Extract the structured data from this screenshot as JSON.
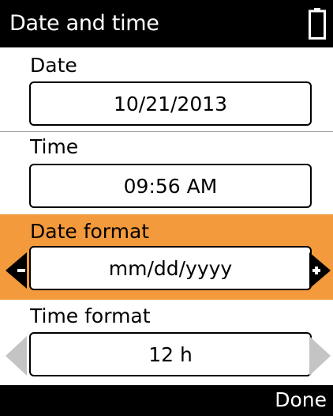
{
  "header": {
    "title": "Date and time",
    "battery_icon": "battery-icon"
  },
  "sections": {
    "date": {
      "label": "Date",
      "value": "10/21/2013"
    },
    "time": {
      "label": "Time",
      "value": "09:56 AM"
    },
    "date_format": {
      "label": "Date format",
      "value": "mm/dd/yyyy",
      "selected": true
    },
    "time_format": {
      "label": "Time format",
      "value": "12 h"
    }
  },
  "footer": {
    "done_label": "Done"
  },
  "colors": {
    "highlight": "#f39a3c",
    "bar": "#000000",
    "inactive_arrow": "#bdbdbd"
  },
  "icons": {
    "left": "left-arrow-icon",
    "right": "right-arrow-icon"
  }
}
